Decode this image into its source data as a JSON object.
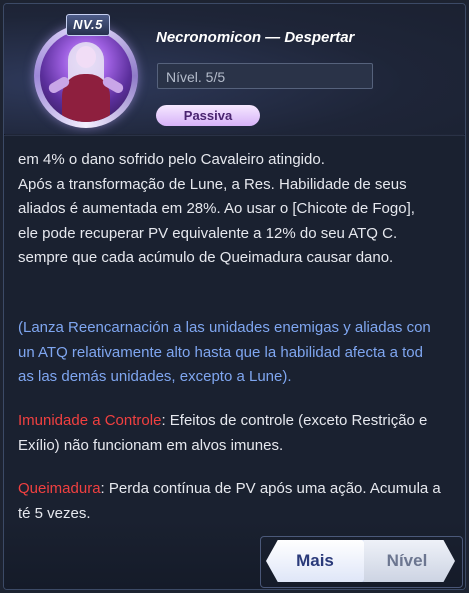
{
  "skill": {
    "level_badge": "NV.5",
    "title": "Necronomicon — Despertar",
    "level_value": "Nível. 5/5",
    "type_badge": "Passiva"
  },
  "description": {
    "paragraph1_lines": [
      "em 4% o dano sofrido pelo Cavaleiro atingido.",
      "Após a transformação de Lune, a Res. Habilidade de seus",
      "aliados é aumentada em 28%. Ao usar o [Chicote de Fogo],",
      "ele pode recuperar PV equivalente a 12% do seu ATQ C.",
      "sempre que cada acúmulo de Queimadura causar dano."
    ],
    "paragraph2_lines": [
      "(Lanza Reencarnación a las unidades enemigas y aliadas con",
      "un ATQ relativamente alto hasta que la habilidad afecta a tod",
      "as las demás unidades, excepto a Lune)."
    ],
    "status1_keyword": "Imunidade a Controle",
    "status1_line1": ": Efeitos de controle (exceto Restrição e",
    "status1_line2": "Exílio) não funcionam em alvos imunes.",
    "status2_keyword": "Queimadura",
    "status2_line1": ": Perda contínua de PV após uma ação. Acumula a",
    "status2_line2": "té 5 vezes."
  },
  "buttons": {
    "more_label": "Mais",
    "level_label": "Nível"
  },
  "colors": {
    "keyword_red": "#f04040",
    "note_blue": "#7fa6f0",
    "badge_purple": "#d6b2f8"
  }
}
